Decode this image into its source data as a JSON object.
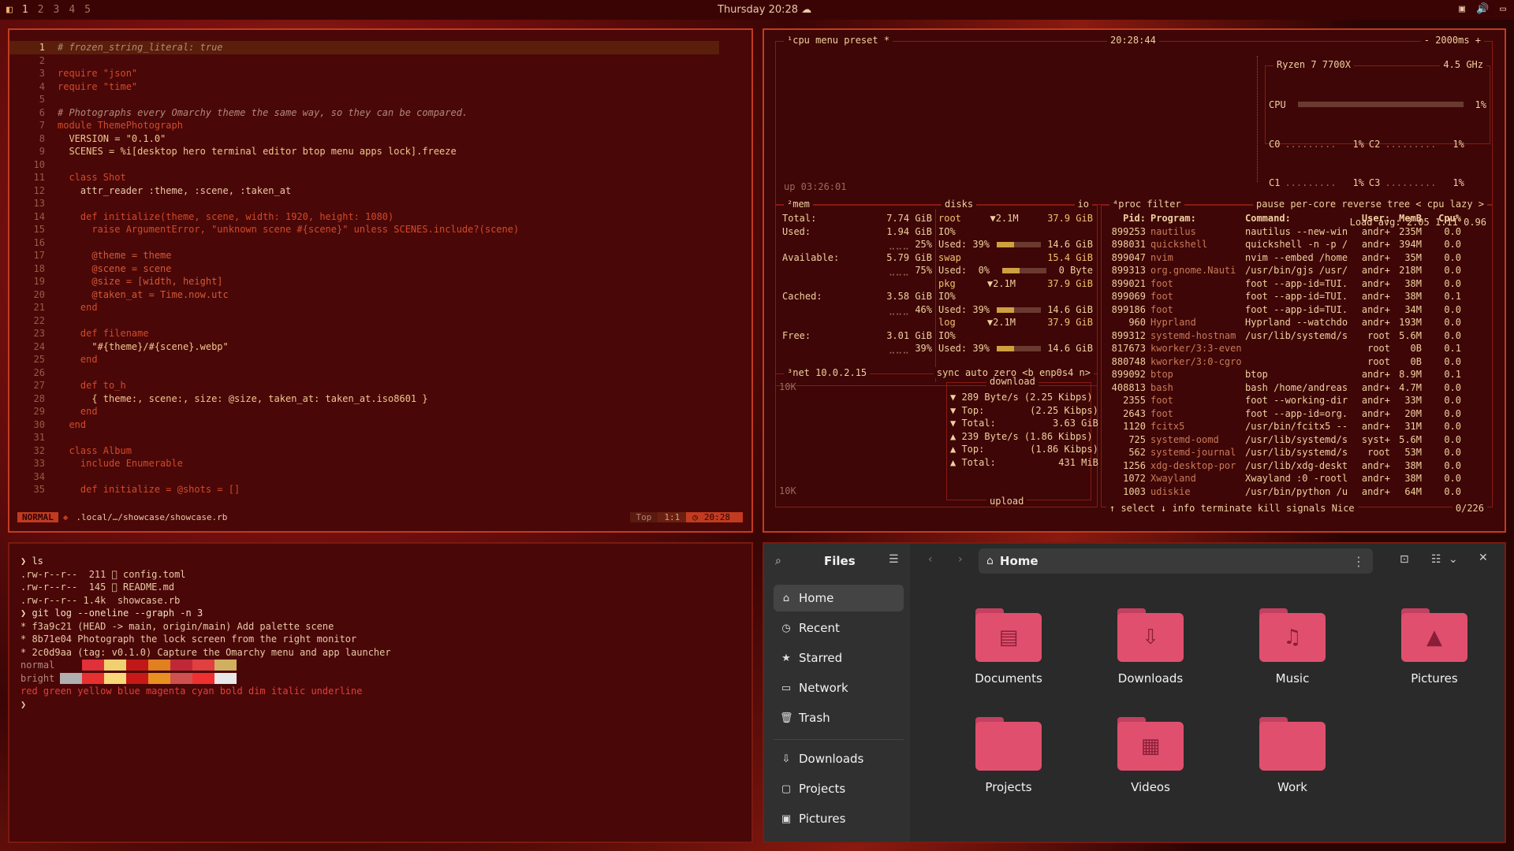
{
  "topbar": {
    "workspaces": [
      "1",
      "2",
      "3",
      "4",
      "5"
    ],
    "clock": "Thursday 20:28",
    "tray_icons": [
      "display-icon",
      "volume-icon",
      "screen-icon"
    ]
  },
  "editor": {
    "lines": [
      {
        "n": "1",
        "t": "# frozen_string_literal: true"
      },
      {
        "n": "2",
        "t": ""
      },
      {
        "n": "3",
        "t": "require \"json\""
      },
      {
        "n": "4",
        "t": "require \"time\""
      },
      {
        "n": "5",
        "t": ""
      },
      {
        "n": "6",
        "t": "# Photographs every Omarchy theme the same way, so they can be compared."
      },
      {
        "n": "7",
        "t": "module ThemePhotograph"
      },
      {
        "n": "8",
        "t": "  VERSION = \"0.1.0\""
      },
      {
        "n": "9",
        "t": "  SCENES = %i[desktop hero terminal editor btop menu apps lock].freeze"
      },
      {
        "n": "10",
        "t": ""
      },
      {
        "n": "11",
        "t": "  class Shot"
      },
      {
        "n": "12",
        "t": "    attr_reader :theme, :scene, :taken_at"
      },
      {
        "n": "13",
        "t": ""
      },
      {
        "n": "14",
        "t": "    def initialize(theme, scene, width: 1920, height: 1080)"
      },
      {
        "n": "15",
        "t": "      raise ArgumentError, \"unknown scene #{scene}\" unless SCENES.include?(scene)"
      },
      {
        "n": "16",
        "t": ""
      },
      {
        "n": "17",
        "t": "      @theme = theme"
      },
      {
        "n": "18",
        "t": "      @scene = scene"
      },
      {
        "n": "19",
        "t": "      @size = [width, height]"
      },
      {
        "n": "20",
        "t": "      @taken_at = Time.now.utc"
      },
      {
        "n": "21",
        "t": "    end"
      },
      {
        "n": "22",
        "t": ""
      },
      {
        "n": "23",
        "t": "    def filename"
      },
      {
        "n": "24",
        "t": "      \"#{theme}/#{scene}.webp\""
      },
      {
        "n": "25",
        "t": "    end"
      },
      {
        "n": "26",
        "t": ""
      },
      {
        "n": "27",
        "t": "    def to_h"
      },
      {
        "n": "28",
        "t": "      { theme:, scene:, size: @size, taken_at: taken_at.iso8601 }"
      },
      {
        "n": "29",
        "t": "    end"
      },
      {
        "n": "30",
        "t": "  end"
      },
      {
        "n": "31",
        "t": ""
      },
      {
        "n": "32",
        "t": "  class Album"
      },
      {
        "n": "33",
        "t": "    include Enumerable"
      },
      {
        "n": "34",
        "t": ""
      },
      {
        "n": "35",
        "t": "    def initialize = @shots = []"
      }
    ],
    "status": {
      "mode": "NORMAL",
      "file": ".local/…/showcase/showcase.rb",
      "pos_label": "Top",
      "cursor": "1:1",
      "time": "20:28"
    }
  },
  "btop": {
    "cpu_header": {
      "left": "¹cpu  menu  preset *",
      "time": "20:28:44",
      "interval": "- 2000ms +"
    },
    "cpu_box": {
      "model": "Ryzen 7 7700X",
      "freq": "4.5 GHz",
      "cpu_label": "CPU",
      "cpu_pct": "1%",
      "cores": [
        {
          "a": "C0",
          "ap": "1%",
          "b": "C2",
          "bp": "1%"
        },
        {
          "a": "C1",
          "ap": "1%",
          "b": "C3",
          "bp": "1%"
        }
      ],
      "load": "Load avg: 2.05 1.11 0.96",
      "uptime": "up 03:26:01"
    },
    "mem": {
      "title": "²mem",
      "total": "Total:",
      "total_v": "7.74 GiB",
      "used": "Used:",
      "used_v": "1.94 GiB",
      "used_p": "25%",
      "avail": "Available:",
      "avail_v": "5.79 GiB",
      "avail_p": "75%",
      "cached": "Cached:",
      "cached_v": "3.58 GiB",
      "cached_p": "46%",
      "free": "Free:",
      "free_v": "3.01 GiB",
      "free_p": "39%"
    },
    "disks": {
      "title": "disks",
      "io": "io",
      "rows": [
        {
          "name": "root",
          "sp": "▼2.1M",
          "size": "37.9 GiB"
        },
        {
          "name": "IO%",
          "sp": "",
          "size": ""
        },
        {
          "name": "Used: 39%",
          "sp": "",
          "size": "14.6 GiB"
        },
        {
          "name": "swap",
          "sp": "",
          "size": "15.4 GiB"
        },
        {
          "name": "Used:  0%",
          "sp": "",
          "size": "0 Byte"
        },
        {
          "name": "pkg",
          "sp": "▼2.1M",
          "size": "37.9 GiB"
        },
        {
          "name": "IO%",
          "sp": "",
          "size": ""
        },
        {
          "name": "Used: 39%",
          "sp": "",
          "size": "14.6 GiB"
        },
        {
          "name": "log",
          "sp": "▼2.1M",
          "size": "37.9 GiB"
        },
        {
          "name": "IO%",
          "sp": "",
          "size": ""
        },
        {
          "name": "Used: 39%",
          "sp": "",
          "size": "14.6 GiB"
        }
      ]
    },
    "net": {
      "title": "³net  10.0.2.15",
      "opts": "sync  auto  zero  <b enp0s4 n>",
      "scale_top": "10K",
      "scale_bot": "10K",
      "download": "download",
      "upload": "upload",
      "rows": [
        "▼ 289 Byte/s (2.25 Kibps)",
        "▼ Top:        (2.25 Kibps)",
        "▼ Total:          3.63 GiB",
        "",
        "▲ 239 Byte/s (1.86 Kibps)",
        "▲ Top:        (1.86 Kibps)",
        "▲ Total:           431 MiB"
      ]
    },
    "proc": {
      "title": "⁴proc  filter",
      "opts": "pause  per-core  reverse  tree  < cpu lazy >",
      "header": [
        "Pid:",
        "Program:",
        "Command:",
        "User:",
        "MemB",
        "Cpu%"
      ],
      "rows": [
        [
          "899253",
          "nautilus",
          "nautilus --new-win",
          "andr+",
          "235M",
          "0.0"
        ],
        [
          "898031",
          "quickshell",
          "quickshell -n -p /",
          "andr+",
          "394M",
          "0.0"
        ],
        [
          "899047",
          "nvim",
          "nvim --embed /home",
          "andr+",
          "35M",
          "0.0"
        ],
        [
          "899313",
          "org.gnome.Nauti",
          "/usr/bin/gjs /usr/",
          "andr+",
          "218M",
          "0.0"
        ],
        [
          "899021",
          "foot",
          "foot --app-id=TUI.",
          "andr+",
          "38M",
          "0.0"
        ],
        [
          "899069",
          "foot",
          "foot --app-id=TUI.",
          "andr+",
          "38M",
          "0.1"
        ],
        [
          "899186",
          "foot",
          "foot --app-id=TUI.",
          "andr+",
          "34M",
          "0.0"
        ],
        [
          "960",
          "Hyprland",
          "Hyprland --watchdo",
          "andr+",
          "193M",
          "0.0"
        ],
        [
          "899312",
          "systemd-hostnam",
          "/usr/lib/systemd/s",
          "root",
          "5.6M",
          "0.0"
        ],
        [
          "817673",
          "kworker/3:3-even",
          "",
          "root",
          "0B",
          "0.1"
        ],
        [
          "880748",
          "kworker/3:0-cgro",
          "",
          "root",
          "0B",
          "0.0"
        ],
        [
          "899092",
          "btop",
          "btop",
          "andr+",
          "8.9M",
          "0.1"
        ],
        [
          "408813",
          "bash",
          "bash /home/andreas",
          "andr+",
          "4.7M",
          "0.0"
        ],
        [
          "2355",
          "foot",
          "foot --working-dir",
          "andr+",
          "33M",
          "0.0"
        ],
        [
          "2643",
          "foot",
          "foot --app-id=org.",
          "andr+",
          "20M",
          "0.0"
        ],
        [
          "1120",
          "fcitx5",
          "/usr/bin/fcitx5 --",
          "andr+",
          "31M",
          "0.0"
        ],
        [
          "725",
          "systemd-oomd",
          "/usr/lib/systemd/s",
          "syst+",
          "5.6M",
          "0.0"
        ],
        [
          "562",
          "systemd-journal",
          "/usr/lib/systemd/s",
          "root",
          "53M",
          "0.0"
        ],
        [
          "1256",
          "xdg-desktop-por",
          "/usr/lib/xdg-deskt",
          "andr+",
          "38M",
          "0.0"
        ],
        [
          "1072",
          "Xwayland",
          "Xwayland :0 -rootl",
          "andr+",
          "38M",
          "0.0"
        ],
        [
          "1003",
          "udiskie",
          "/usr/bin/python /u",
          "andr+",
          "64M",
          "0.0"
        ]
      ],
      "footer": "↑ select ↓ info  terminate  kill  signals  Nice",
      "count": "0/226"
    }
  },
  "terminal": {
    "lines": [
      {
        "cls": "prompt",
        "t": "❯ ls"
      },
      {
        "cls": "",
        "t": ".rw-r--r--  211 󰒓 config.toml"
      },
      {
        "cls": "",
        "t": ".rw-r--r--  145 󰂺 README.md"
      },
      {
        "cls": "",
        "t": ".rw-r--r-- 1.4k  showcase.rb"
      },
      {
        "cls": "prompt",
        "t": "❯ git log --oneline --graph -n 3"
      },
      {
        "cls": "",
        "t": "* f3a9c21 (HEAD -> main, origin/main) Add palette scene"
      },
      {
        "cls": "",
        "t": "* 8b71e04 Photograph the lock screen from the right monitor"
      },
      {
        "cls": "",
        "t": "* 2c0d9aa (tag: v0.1.0) Capture the Omarchy menu and app launcher"
      }
    ],
    "normal_label": "normal",
    "bright_label": "bright",
    "normal_colors": [
      "#4a0707",
      "#e0303a",
      "#f0d070",
      "#c01818",
      "#e08020",
      "#c02838",
      "#e04040",
      "#d0b060"
    ],
    "bright_colors": [
      "#b0b0b0",
      "#e83030",
      "#f8d878",
      "#c81818",
      "#e89020",
      "#d05050",
      "#f03030",
      "#e8e8e8"
    ],
    "styles_line": "red green yellow blue magenta cyan bold dim italic underline",
    "last_prompt": "❯"
  },
  "files": {
    "title": "Files",
    "location": "Home",
    "sidebar": [
      {
        "label": "Home",
        "icon": "home-icon",
        "glyph": "⌂"
      },
      {
        "label": "Recent",
        "icon": "clock-icon",
        "glyph": "◷"
      },
      {
        "label": "Starred",
        "icon": "star-icon",
        "glyph": "★"
      },
      {
        "label": "Network",
        "icon": "network-icon",
        "glyph": "▭"
      },
      {
        "label": "Trash",
        "icon": "trash-icon",
        "glyph": "🗑"
      },
      {
        "label": "Downloads",
        "icon": "download-icon",
        "glyph": "⇩"
      },
      {
        "label": "Projects",
        "icon": "folder-icon",
        "glyph": "▢"
      },
      {
        "label": "Pictures",
        "icon": "picture-icon",
        "glyph": "▣"
      }
    ],
    "folders": [
      {
        "label": "Documents",
        "glyph": "▤"
      },
      {
        "label": "Downloads",
        "glyph": "⇩"
      },
      {
        "label": "Music",
        "glyph": "♫"
      },
      {
        "label": "Pictures",
        "glyph": "▲"
      },
      {
        "label": "Projects",
        "glyph": ""
      },
      {
        "label": "Videos",
        "glyph": "▦"
      },
      {
        "label": "Work",
        "glyph": ""
      }
    ]
  }
}
